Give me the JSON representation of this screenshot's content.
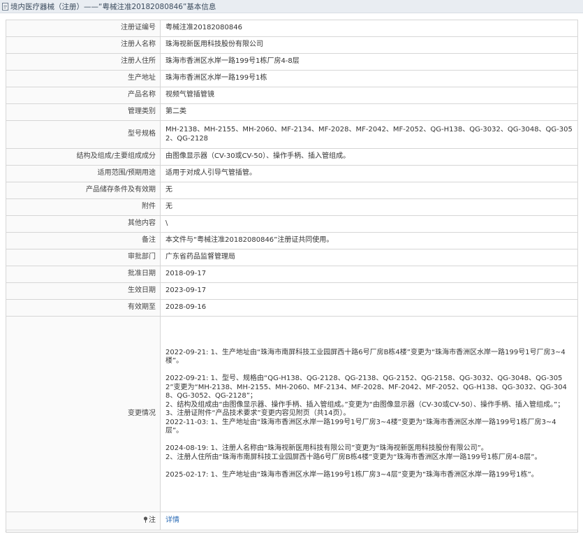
{
  "header": {
    "title": "境内医疗器械（注册）——“粤械注准20182080846”基本信息"
  },
  "rows": [
    {
      "label": "注册证编号",
      "value": "粤械注准20182080846"
    },
    {
      "label": "注册人名称",
      "value": "珠海视新医用科技股份有限公司"
    },
    {
      "label": "注册人住所",
      "value": "珠海市香洲区水岸一路199号1栋厂房4-8层"
    },
    {
      "label": "生产地址",
      "value": "珠海市香洲区水岸一路199号1栋"
    },
    {
      "label": "产品名称",
      "value": "视频气管插管镜"
    },
    {
      "label": "管理类别",
      "value": "第二类"
    },
    {
      "label": "型号规格",
      "value": "MH-2138、MH-2155、MH-2060、MF-2134、MF-2028、MF-2042、MF-2052、QG-H138、QG-3032、QG-3048、QG-3052、QG-2128"
    },
    {
      "label": "结构及组成/主要组成成分",
      "value": "由图像显示器（CV-30或CV-50）、操作手柄、插入管组成。"
    },
    {
      "label": "适用范围/预期用途",
      "value": "适用于对成人引导气管插管。"
    },
    {
      "label": "产品储存条件及有效期",
      "value": "无"
    },
    {
      "label": "附件",
      "value": "无"
    },
    {
      "label": "其他内容",
      "value": "\\"
    },
    {
      "label": "备注",
      "value": "本文件与“粤械注准20182080846”注册证共同使用。"
    },
    {
      "label": "审批部门",
      "value": "广东省药品监督管理局"
    },
    {
      "label": "批准日期",
      "value": "2018-09-17"
    },
    {
      "label": "生效日期",
      "value": "2023-09-17"
    },
    {
      "label": "有效期至",
      "value": "2028-09-16"
    }
  ],
  "changes": {
    "label": "变更情况",
    "lines": [
      "2022-09-21: 1、生产地址由“珠海市南屏科技工业园屏西十路6号厂房B栋4楼”变更为“珠海市香洲区水岸一路199号1号厂房3~4楼”。",
      "",
      "2022-09-21: 1、型号、规格由“QG-H138、QG-2128、QG-2138、QG-2152、QG-2158、QG-3032、QG-3048、QG-3052”变更为“MH-2138、MH-2155、MH-2060、MF-2134、MF-2028、MF-2042、MF-2052、QG-H138、QG-3032、QG-3048、QG-3052、QG-2128”；",
      "2、结构及组成由“由图像显示器、操作手柄、插入管组成。”变更为“由图像显示器（CV-30或CV-50）、操作手柄、插入管组成。”；",
      "3、注册证附件“产品技术要求”变更内容见附页（共14页）。",
      "2022-11-03: 1、生产地址由“珠海市香洲区水岸一路199号1号厂房3~4楼”变更为“珠海市香洲区水岸一路199号1栋厂房3~4层”。",
      "",
      "2024-08-19: 1、注册人名称由“珠海视新医用科技有限公司”变更为“珠海视新医用科技股份有限公司”。",
      "2、注册人住所由“珠海市南屏科技工业园屏西十路6号厂房B栋4楼”变更为“珠海市香洲区水岸一路199号1栋厂房4-8层”。",
      "",
      "2025-02-17: 1、生产地址由“珠海市香洲区水岸一路199号1栋厂房3~4层”变更为“珠海市香洲区水岸一路199号1栋”。"
    ]
  },
  "note": {
    "label": "注",
    "link": "详情",
    "icon": "pin-icon"
  },
  "colors": {
    "header_bg": "#e9edf2",
    "border": "#d6d6d6",
    "link": "#2a6bb5"
  }
}
